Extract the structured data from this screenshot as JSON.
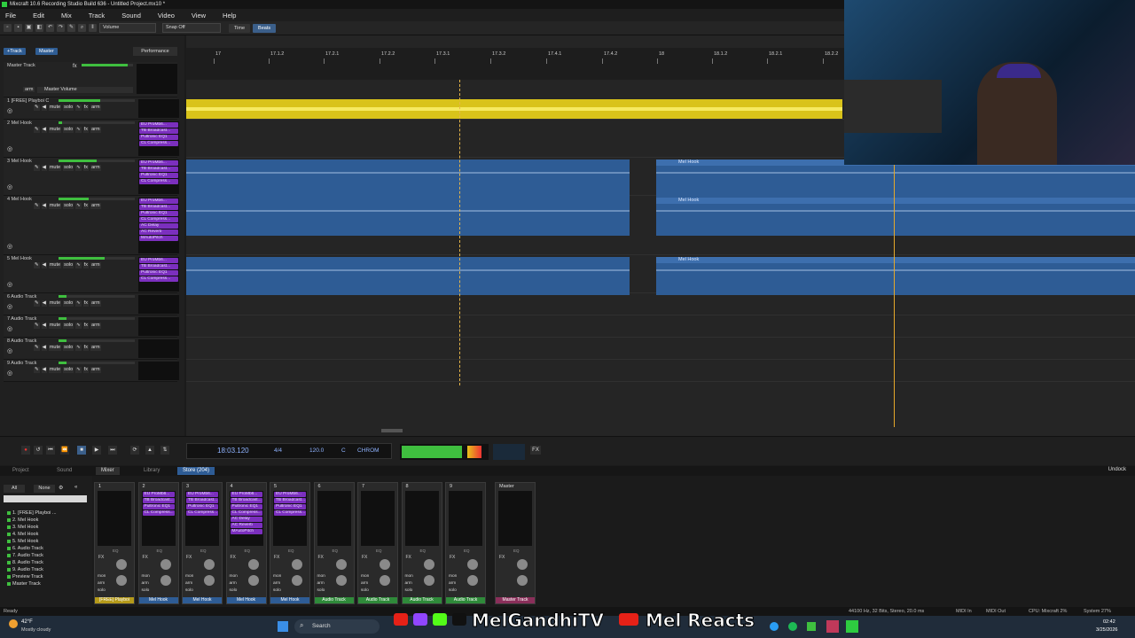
{
  "window": {
    "title": "Mixcraft 10.6 Recording Studio Build 636 - Untitled Project.mx10 *"
  },
  "menu": [
    "File",
    "Edit",
    "Mix",
    "Track",
    "Sound",
    "Video",
    "View",
    "Help"
  ],
  "toolbar": {
    "volume_select": "Volume",
    "snap_select": "Snap Off",
    "time_btn": "Time",
    "beats_btn": "Beats"
  },
  "left_tools": {
    "add_track": "+Track",
    "master": "Master",
    "performance": "Performance"
  },
  "master_track": {
    "name": "Master Track",
    "arm": "arm",
    "volume": "Master Volume"
  },
  "track_buttons": {
    "mute": "mute",
    "solo": "solo",
    "arm": "arm",
    "fx": "fx"
  },
  "tracks": [
    {
      "num": "1",
      "name": "[FREE] Playboi C",
      "fx": []
    },
    {
      "num": "2",
      "name": "Mel Hook",
      "fx": [
        "EU ProMb6...",
        "TB Broadcast...",
        "Pultronic EQ1",
        "CL Compress..."
      ]
    },
    {
      "num": "3",
      "name": "Mel Hook",
      "fx": [
        "EU ProMb6...",
        "TB Broadcast...",
        "Pultronic EQ1",
        "CL Compress..."
      ]
    },
    {
      "num": "4",
      "name": "Mel Hook",
      "fx": [
        "EU ProMb6...",
        "TB Broadcast...",
        "Pultronic EQ1",
        "CL Compress...",
        "AC Delay",
        "AC Reverb",
        "MAutoPitch"
      ]
    },
    {
      "num": "5",
      "name": "Mel Hook",
      "fx": [
        "EU ProMb6...",
        "TB Broadcast...",
        "Pultronic EQ1",
        "CL Compress..."
      ]
    },
    {
      "num": "6",
      "name": "Audio Track",
      "fx": []
    },
    {
      "num": "7",
      "name": "Audio Track",
      "fx": []
    },
    {
      "num": "8",
      "name": "Audio Track",
      "fx": []
    },
    {
      "num": "9",
      "name": "Audio Track",
      "fx": []
    }
  ],
  "ruler": [
    "17",
    "17.1.2",
    "17.2.1",
    "17.2.2",
    "17.3.1",
    "17.3.2",
    "17.4.1",
    "17.4.2",
    "18",
    "18.1.2",
    "18.2.1",
    "18.2.2"
  ],
  "clips": {
    "label": "Mel Hook"
  },
  "transport": {
    "time": "18:03.120",
    "signature": "4/4",
    "tempo": "120.0",
    "key": "C",
    "mode": "CHROM",
    "fx": "FX"
  },
  "bottom_tabs": [
    "Project",
    "Sound",
    "Mixer",
    "Library",
    "Store (204)"
  ],
  "undock": "Undock",
  "mixer_filter": {
    "all": "All",
    "none": "None"
  },
  "mixer_tracks": [
    "1. [FREE] Playboi ...",
    "2. Mel Hook",
    "3. Mel Hook",
    "4. Mel Hook",
    "5. Mel Hook",
    "6. Audio Track",
    "7. Audio Track",
    "8. Audio Track",
    "9. Audio Track",
    "Preview Track",
    "Master Track"
  ],
  "strips": [
    {
      "num": "1",
      "label": "[FREE] Playboi",
      "style": "gold",
      "fx": []
    },
    {
      "num": "2",
      "label": "Mel Hook",
      "style": "blue",
      "fx": [
        "EU ProMb6...",
        "TB Broadcast...",
        "Pultronic EQ1",
        "CL Compress..."
      ]
    },
    {
      "num": "3",
      "label": "Mel Hook",
      "style": "blue",
      "fx": [
        "EU ProMb6...",
        "TB Broadcast...",
        "Pultronic EQ1",
        "CL Compress..."
      ]
    },
    {
      "num": "4",
      "label": "Mel Hook",
      "style": "blue",
      "fx": [
        "EU ProMb6...",
        "TB Broadcast...",
        "Pultronic EQ1",
        "CL Compress...",
        "AC Delay",
        "AC Reverb",
        "MAutoPitch"
      ]
    },
    {
      "num": "5",
      "label": "Mel Hook",
      "style": "blue",
      "fx": [
        "EU ProMb6...",
        "TB Broadcast...",
        "Pultronic EQ1",
        "CL Compress..."
      ]
    },
    {
      "num": "6",
      "label": "Audio Track",
      "style": "green",
      "fx": []
    },
    {
      "num": "7",
      "label": "Audio Track",
      "style": "green",
      "fx": []
    },
    {
      "num": "8",
      "label": "Audio Track",
      "style": "green",
      "fx": []
    },
    {
      "num": "9",
      "label": "Audio Track",
      "style": "green",
      "fx": []
    }
  ],
  "master_strip": {
    "num": "Master",
    "label": "Master Track"
  },
  "strip_text": {
    "fx": "FX",
    "eq": "EQ",
    "mon": "mon",
    "arm": "arm",
    "solo": "solo"
  },
  "status": {
    "left": "Ready",
    "audio": "44100 Hz, 32 Bits, Stereo, 20.0 ms",
    "midi_in": "MIDI In",
    "midi_out": "MIDI Out",
    "cpu": "CPU: Mixcraft 2%",
    "system": "System 27%"
  },
  "taskbar": {
    "weather_temp": "42°F",
    "weather": "Mostly cloudy",
    "search": "Search",
    "time": "02:42",
    "date": "3/25/2026"
  },
  "overlay": {
    "channel1": "MelGandhiTV",
    "channel2": "Mel Reacts"
  },
  "colors": {
    "accent": "#2e5c95",
    "yellow_clip": "#d9c31a",
    "fx_chip": "#7b2fbe",
    "playhead": "#e6a82a"
  }
}
